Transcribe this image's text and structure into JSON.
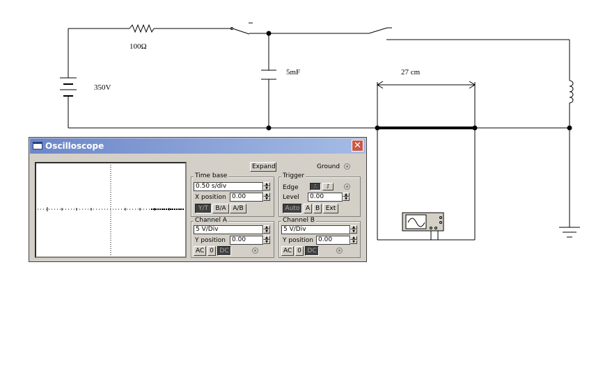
{
  "circuit": {
    "resistor_label": "100Ω",
    "battery_label": "350V",
    "capacitor_label": "5mF",
    "length_label": "27 cm"
  },
  "oscilloscope": {
    "title": "Oscilloscope",
    "expand_label": "Expand",
    "ground_label": "Ground",
    "time_base": {
      "legend": "Time base",
      "value": "0.50 s/div",
      "x_position_label": "X position",
      "x_position_value": "0.00",
      "modes": [
        "Y/T",
        "B/A",
        "A/B"
      ]
    },
    "trigger": {
      "legend": "Trigger",
      "edge_label": "Edge",
      "level_label": "Level",
      "level_value": "0.00",
      "sources": [
        "Auto",
        "A",
        "B",
        "Ext"
      ]
    },
    "channel_a": {
      "legend": "Channel A",
      "value": "5 V/Div",
      "y_position_label": "Y position",
      "y_position_value": "0.00",
      "coupling": [
        "AC",
        "0",
        "DC"
      ]
    },
    "channel_b": {
      "legend": "Channel B",
      "value": "5 V/Div",
      "y_position_label": "Y position",
      "y_position_value": "0.00",
      "coupling": [
        "AC",
        "0",
        "DC"
      ]
    }
  }
}
